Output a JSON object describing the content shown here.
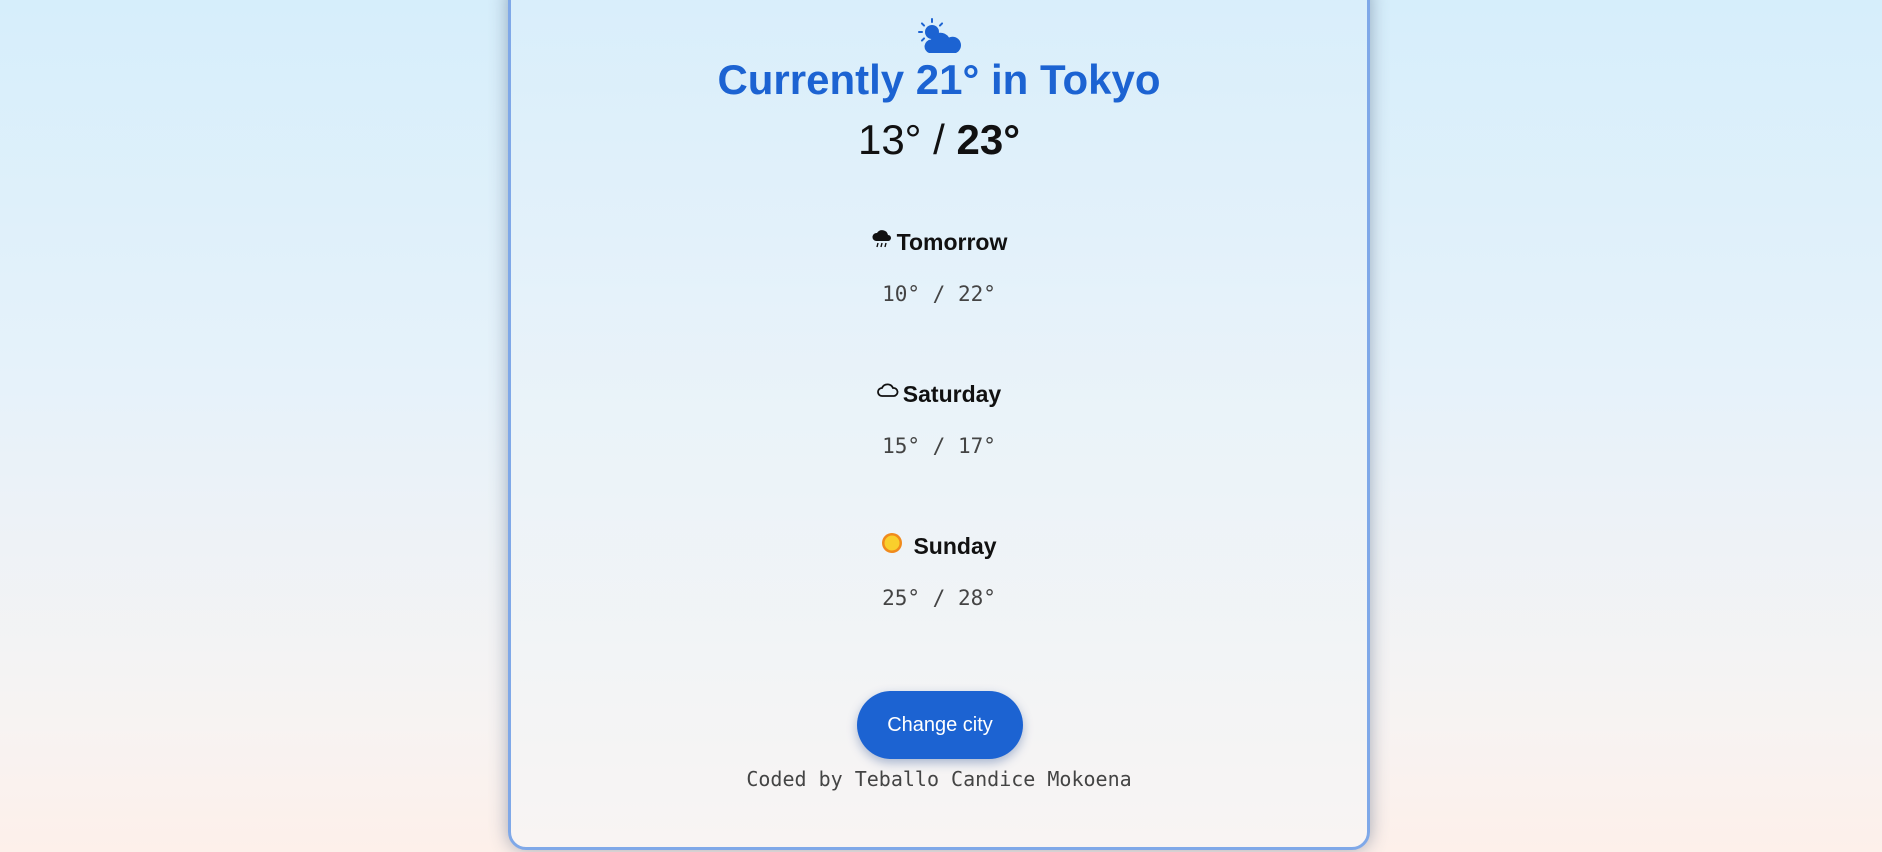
{
  "current": {
    "icon": "sun-behind-cloud-icon",
    "headline": "Currently 21° in Tokyo",
    "low": "13°",
    "separator": " / ",
    "high": "23°"
  },
  "forecast": [
    {
      "icon": "rain-cloud-icon",
      "day": "Tomorrow",
      "range": "10° / 22°"
    },
    {
      "icon": "cloud-outline-icon",
      "day": "Saturday",
      "range": "15° / 17°"
    },
    {
      "icon": "sun-icon",
      "day": "Sunday",
      "range": "25° / 28°"
    }
  ],
  "actions": {
    "change_city_label": "Change city"
  },
  "footer": {
    "credit": "Coded by Teballo Candice Mokoena"
  },
  "colors": {
    "accent": "#1c63d2",
    "card_border": "#7fa8e8"
  }
}
